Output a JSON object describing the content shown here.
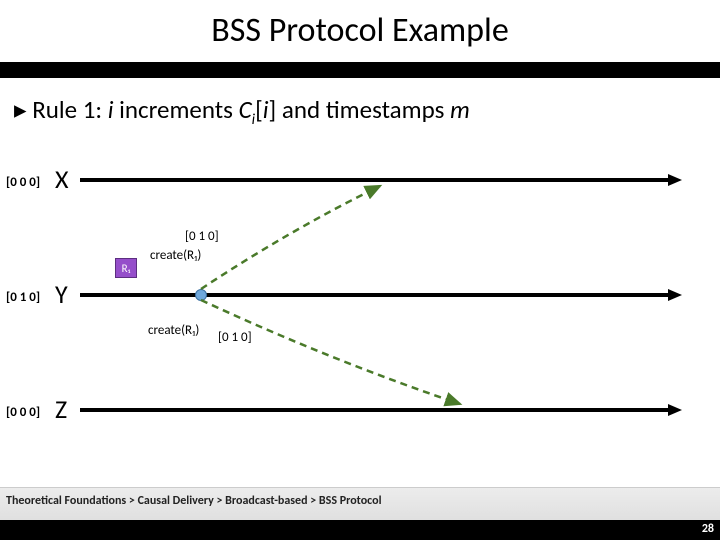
{
  "title": "BSS Protocol Example",
  "rule": {
    "bullet": "▸",
    "prefix": "Rule 1: ",
    "iword": "i",
    "mid1": " increments ",
    "cvar": "C",
    "csub": "i",
    "bracket": "[",
    "ivar2": "i",
    "bracket2": "]",
    "mid2": " and timestamps ",
    "mword": "m"
  },
  "nodes": {
    "x": "X",
    "y": "Y",
    "z": "Z"
  },
  "labels": {
    "x": "[0 0 0]",
    "y": "[0 1 0]",
    "z": "[0 0 0]"
  },
  "r1": "R₁",
  "event": {
    "ts_above": "[0 1 0]",
    "create_above": "create(R₁)",
    "create_below": "create(R₁)",
    "ts_below": "[0 1 0]"
  },
  "breadcrumb": "Theoretical Foundations > Causal Delivery > Broadcast-based > BSS Protocol",
  "page": "28"
}
